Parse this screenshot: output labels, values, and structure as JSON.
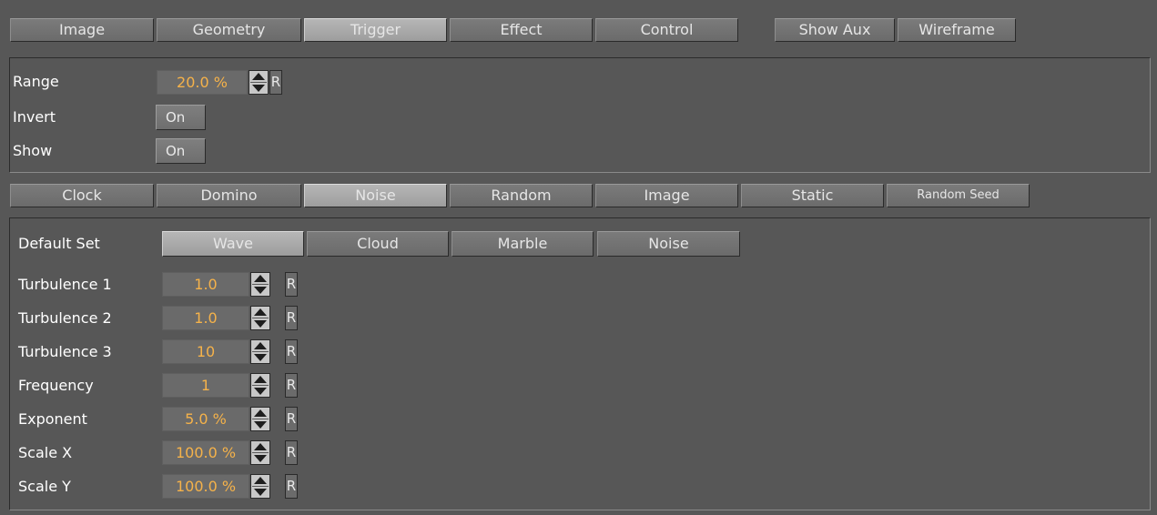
{
  "top_tabs": {
    "image": "Image",
    "geometry": "Geometry",
    "trigger": "Trigger",
    "effect": "Effect",
    "control": "Control",
    "show_aux": "Show Aux",
    "wireframe": "Wireframe",
    "active": "Trigger"
  },
  "trigger_panel": {
    "range_label": "Range",
    "range_value": "20.0 %",
    "reset_label": "R",
    "invert_label": "Invert",
    "invert_value": "On",
    "show_label": "Show",
    "show_value": "On"
  },
  "trigger_tabs": {
    "clock": "Clock",
    "domino": "Domino",
    "noise": "Noise",
    "random": "Random",
    "image": "Image",
    "static": "Static",
    "random_seed": "Random Seed",
    "active": "Noise"
  },
  "noise_panel": {
    "default_set_label": "Default Set",
    "presets": [
      "Wave",
      "Cloud",
      "Marble",
      "Noise"
    ],
    "active_preset": "Wave",
    "params": [
      {
        "label": "Turbulence 1",
        "value": "1.0"
      },
      {
        "label": "Turbulence 2",
        "value": "1.0"
      },
      {
        "label": "Turbulence 3",
        "value": "10"
      },
      {
        "label": "Frequency",
        "value": "1"
      },
      {
        "label": "Exponent",
        "value": "5.0 %"
      },
      {
        "label": "Scale X",
        "value": "100.0 %"
      },
      {
        "label": "Scale Y",
        "value": "100.0 %"
      }
    ],
    "reset_label": "R"
  },
  "colors": {
    "background": "#575757",
    "value_text": "#f5b24a",
    "active_tab": "#aaaaaa",
    "tab": "#737373"
  }
}
